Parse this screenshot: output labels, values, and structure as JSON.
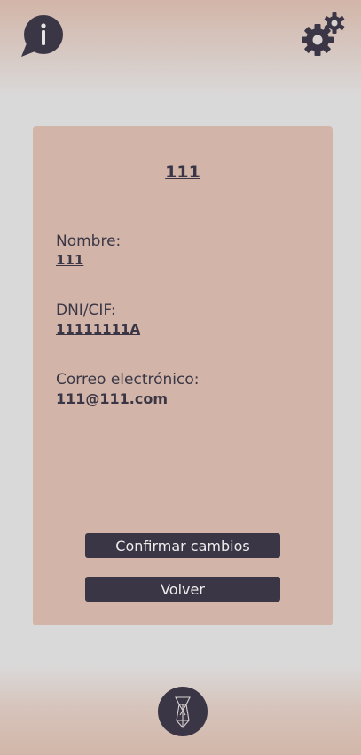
{
  "header": {
    "info_icon": "info-speech-bubble-icon",
    "settings_icon": "gears-icon"
  },
  "card": {
    "title": "111",
    "fields": [
      {
        "label": "Nombre:",
        "value": "111"
      },
      {
        "label": "DNI/CIF:",
        "value": "11111111A"
      },
      {
        "label": "Correo electrónico:",
        "value": "111@111.com"
      }
    ],
    "buttons": {
      "confirm": "Confirmar cambios",
      "back": "Volver"
    }
  },
  "footer": {
    "logo_icon": "tie-logo-icon"
  },
  "colors": {
    "primary_dark": "#3a3646",
    "card_bg": "#d2b5a8",
    "page_bg": "#dad9d9",
    "button_text": "#f1ecec"
  }
}
